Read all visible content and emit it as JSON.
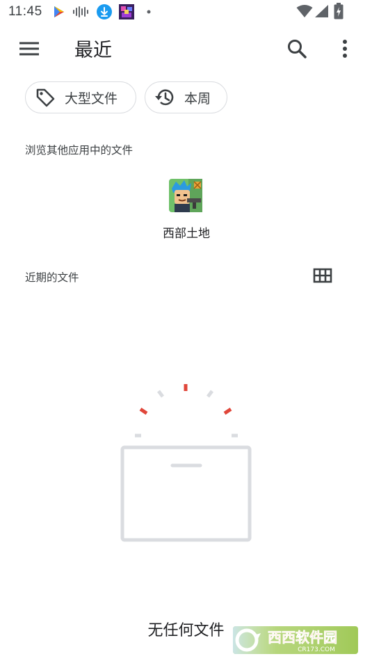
{
  "status_bar": {
    "time": "11:45"
  },
  "app_bar": {
    "title": "最近",
    "menu_icon": "hamburger-menu-icon",
    "search_icon": "search-icon",
    "overflow_icon": "more-vert-icon"
  },
  "chips": [
    {
      "label": "大型文件",
      "icon": "tag-icon"
    },
    {
      "label": "本周",
      "icon": "history-icon"
    }
  ],
  "browse_section": {
    "label": "浏览其他应用中的文件",
    "apps": [
      {
        "label": "西部土地",
        "icon": "game-app-icon"
      }
    ]
  },
  "recent_section": {
    "label": "近期的文件",
    "view_toggle_icon": "grid-view-icon"
  },
  "empty_state": {
    "message": "无任何文件"
  },
  "watermark": {
    "brand": "西西软件园",
    "url": "CR173.COM"
  },
  "colors": {
    "accent_red": "#e0463a",
    "placeholder_gray": "#dadce0",
    "text_primary": "#202124",
    "text_secondary": "#3c4043"
  }
}
